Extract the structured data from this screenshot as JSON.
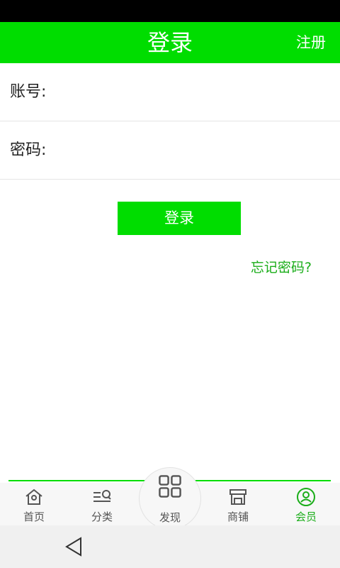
{
  "header": {
    "title": "登录",
    "register_label": "注册"
  },
  "form": {
    "account_label": "账号:",
    "password_label": "密码:",
    "account_value": "",
    "password_value": ""
  },
  "login_button_label": "登录",
  "forgot_password_label": "忘记密码?",
  "tabbar": {
    "tabs": [
      {
        "label": "首页",
        "icon": "home-icon",
        "active": false
      },
      {
        "label": "分类",
        "icon": "category-icon",
        "active": false
      },
      {
        "label": "发现",
        "icon": "discover-grid-icon",
        "active": false
      },
      {
        "label": "商铺",
        "icon": "store-icon",
        "active": false
      },
      {
        "label": "会员",
        "icon": "member-icon",
        "active": true
      }
    ]
  },
  "navigation_bar": {
    "back_icon": "back-triangle-icon"
  },
  "colors": {
    "brand_green": "#00dd00",
    "link_green": "#1aad19",
    "inactive_gray": "#555555"
  }
}
